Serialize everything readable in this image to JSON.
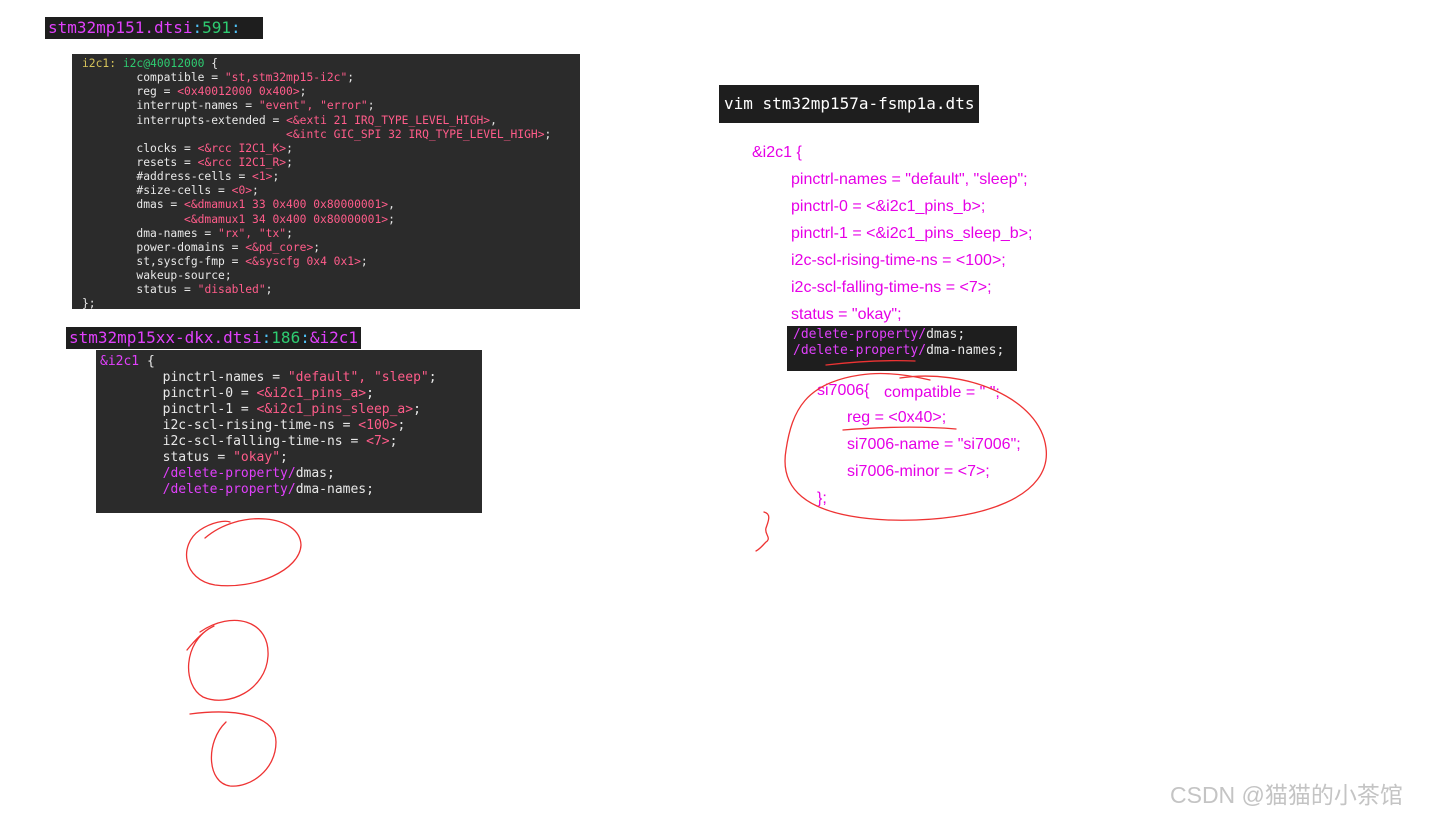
{
  "header1": {
    "file": "stm32mp151.dtsi",
    "sep": ":",
    "line": "591",
    "trail": ":"
  },
  "term1": {
    "lines": [
      [
        [
          "y",
          "i2c1: "
        ],
        [
          "g",
          "i2c@40012000"
        ],
        [
          "w",
          " {"
        ]
      ],
      [
        [
          "w",
          "\tcompatible = "
        ],
        [
          "r",
          "\"st,stm32mp15-i2c\""
        ],
        [
          "w",
          ";"
        ]
      ],
      [
        [
          "w",
          "\treg = "
        ],
        [
          "r",
          "<0x40012000 0x400>"
        ],
        [
          "w",
          ";"
        ]
      ],
      [
        [
          "w",
          "\tinterrupt-names = "
        ],
        [
          "r",
          "\"event\", \"error\""
        ],
        [
          "w",
          ";"
        ]
      ],
      [
        [
          "w",
          "\tinterrupts-extended = "
        ],
        [
          "r",
          "<&exti 21 IRQ_TYPE_LEVEL_HIGH>"
        ],
        [
          "w",
          ","
        ]
      ],
      [
        [
          "w",
          "\t\t\t      "
        ],
        [
          "r",
          "<&intc GIC_SPI 32 IRQ_TYPE_LEVEL_HIGH>"
        ],
        [
          "w",
          ";"
        ]
      ],
      [
        [
          "w",
          "\tclocks = "
        ],
        [
          "r",
          "<&rcc I2C1_K>"
        ],
        [
          "w",
          ";"
        ]
      ],
      [
        [
          "w",
          "\tresets = "
        ],
        [
          "r",
          "<&rcc I2C1_R>"
        ],
        [
          "w",
          ";"
        ]
      ],
      [
        [
          "w",
          "\t#address-cells = "
        ],
        [
          "r",
          "<1>"
        ],
        [
          "w",
          ";"
        ]
      ],
      [
        [
          "w",
          "\t#size-cells = "
        ],
        [
          "r",
          "<0>"
        ],
        [
          "w",
          ";"
        ]
      ],
      [
        [
          "w",
          "\tdmas = "
        ],
        [
          "r",
          "<&dmamux1 33 0x400 0x80000001>"
        ],
        [
          "w",
          ","
        ]
      ],
      [
        [
          "w",
          "\t       "
        ],
        [
          "r",
          "<&dmamux1 34 0x400 0x80000001>"
        ],
        [
          "w",
          ";"
        ]
      ],
      [
        [
          "w",
          "\tdma-names = "
        ],
        [
          "r",
          "\"rx\", \"tx\""
        ],
        [
          "w",
          ";"
        ]
      ],
      [
        [
          "w",
          "\tpower-domains = "
        ],
        [
          "r",
          "<&pd_core>"
        ],
        [
          "w",
          ";"
        ]
      ],
      [
        [
          "w",
          "\tst,syscfg-fmp = "
        ],
        [
          "r",
          "<&syscfg 0x4 0x1>"
        ],
        [
          "w",
          ";"
        ]
      ],
      [
        [
          "w",
          "\twakeup-source;"
        ]
      ],
      [
        [
          "w",
          "\tstatus = "
        ],
        [
          "r",
          "\"disabled\""
        ],
        [
          "w",
          ";"
        ]
      ],
      [
        [
          "w",
          "};"
        ]
      ]
    ]
  },
  "header2": {
    "file": "stm32mp15xx-dkx.dtsi",
    "sep": ":",
    "line": "186",
    "sep2": ":",
    "ref": "&i2c1"
  },
  "term2": {
    "lines": [
      [
        [
          "m",
          "&i2c1"
        ],
        [
          "w",
          " {"
        ]
      ],
      [
        [
          "w",
          "\tpinctrl-names = "
        ],
        [
          "r",
          "\"default\", \"sleep\""
        ],
        [
          "w",
          ";"
        ]
      ],
      [
        [
          "w",
          "\tpinctrl-0 = "
        ],
        [
          "r",
          "<&i2c1_pins_a>"
        ],
        [
          "w",
          ";"
        ]
      ],
      [
        [
          "w",
          "\tpinctrl-1 = "
        ],
        [
          "r",
          "<&i2c1_pins_sleep_a>"
        ],
        [
          "w",
          ";"
        ]
      ],
      [
        [
          "w",
          "\ti2c-scl-rising-time-ns = "
        ],
        [
          "r",
          "<100>"
        ],
        [
          "w",
          ";"
        ]
      ],
      [
        [
          "w",
          "\ti2c-scl-falling-time-ns = "
        ],
        [
          "r",
          "<7>"
        ],
        [
          "w",
          ";"
        ]
      ],
      [
        [
          "w",
          "\tstatus = "
        ],
        [
          "r",
          "\"okay\""
        ],
        [
          "w",
          ";"
        ]
      ],
      [
        [
          "w",
          "\t"
        ],
        [
          "m",
          "/delete-property/"
        ],
        [
          "w",
          "dmas;"
        ]
      ],
      [
        [
          "w",
          "\t"
        ],
        [
          "m",
          "/delete-property/"
        ],
        [
          "w",
          "dma-names;"
        ]
      ]
    ]
  },
  "vim_command": "vim stm32mp157a-fsmp1a.dts",
  "notes": {
    "open": "&i2c1 {",
    "l1": "pinctrl-names = \"default\", \"sleep\";",
    "l2": "pinctrl-0 = <&i2c1_pins_b>;",
    "l3": "pinctrl-1 = <&i2c1_pins_sleep_b>;",
    "l4": "i2c-scl-rising-time-ns = <100>;",
    "l5": "i2c-scl-falling-time-ns = <7>;",
    "l6": "status = \"okay\";",
    "s_open": "si7006{",
    "s_compat": "compatible = \" \";",
    "s_reg": "reg = <0x40>;",
    "s_name": "si7006-name = \"si7006\";",
    "s_minor": "si7006-minor = <7>;",
    "s_close": "};"
  },
  "delete_block": {
    "kw": "/delete-property/",
    "p1": "dmas;",
    "p2": "dma-names;"
  },
  "watermark": "CSDN @猫猫的小茶馆",
  "colors": {
    "annotation": "#e600e6",
    "ink": "#ee3333",
    "terminal_bg": "#2b2b2b"
  }
}
